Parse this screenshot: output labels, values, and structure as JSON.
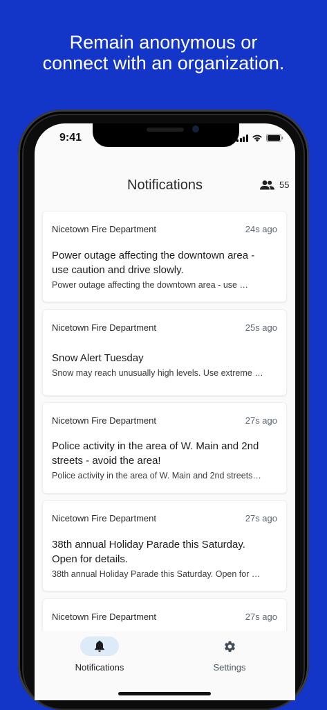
{
  "headline": {
    "line1": "Remain anonymous or",
    "line2": "connect with an organization."
  },
  "status_bar": {
    "time": "9:41"
  },
  "header": {
    "title": "Notifications",
    "member_count": "55"
  },
  "notifications": [
    {
      "source": "Nicetown Fire Department",
      "time_ago": "24s ago",
      "title": "Power outage affecting the downtown area - use caution and drive slowly.",
      "preview": "Power outage affecting the downtown area - use …"
    },
    {
      "source": "Nicetown Fire Department",
      "time_ago": "25s ago",
      "title": "Snow Alert Tuesday",
      "preview": "Snow may reach unusually high levels.  Use extreme …"
    },
    {
      "source": "Nicetown Fire Department",
      "time_ago": "27s ago",
      "title": "Police activity in the area of W. Main and 2nd streets - avoid the area!",
      "preview": "Police activity in the area of W. Main and 2nd streets…"
    },
    {
      "source": "Nicetown Fire Department",
      "time_ago": "27s ago",
      "title": "38th annual Holiday Parade this Saturday. Open for details.",
      "preview": "38th annual Holiday Parade this Saturday. Open for …"
    },
    {
      "source": "Nicetown Fire Department",
      "time_ago": "27s ago"
    }
  ],
  "tabs": [
    {
      "label": "Notifications",
      "icon": "bell-icon",
      "active": true
    },
    {
      "label": "Settings",
      "icon": "gear-icon",
      "active": false
    }
  ],
  "colors": {
    "background": "#1436c8",
    "active_tab_pill": "#dcebf7",
    "active_tab_text": "#1f1f1f",
    "inactive_tab_text": "#4a5560"
  }
}
